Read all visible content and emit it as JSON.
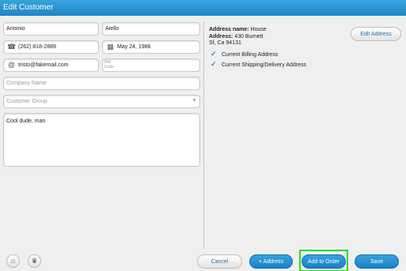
{
  "title": "Edit Customer",
  "form": {
    "first_name": "Antonio",
    "last_name": "Aiello",
    "phone": "(262) 818-2889",
    "birthday": "May 24, 1986",
    "email": "tristo@fakemail.com",
    "ref_code_placeholder": "Ref\nCode",
    "company_placeholder": "Company Name",
    "group_placeholder": "Customer Group",
    "notes": "Cool dude, man"
  },
  "address": {
    "name_label": "Address name:",
    "name_value": "House",
    "address_label": "Address:",
    "line1": "430 Burnett",
    "line2": "Sf, Ca 94131",
    "billing": "Current Billing Address",
    "shipping": "Current Shipping/Delivery Address",
    "edit_label": "Edit Address"
  },
  "footer": {
    "cancel": "Cancel",
    "add_address": "+ Address",
    "add_to_order": "Add to Order",
    "save": "Save"
  },
  "icons": {
    "phone": "phone-icon",
    "calendar": "calendar-icon",
    "email": "at-icon",
    "gift": "gift-icon",
    "trophy": "trophy-icon"
  },
  "colors": {
    "title_bar": "#2a95d3",
    "primary_button": "#1f86c6",
    "highlight": "#22e01a"
  }
}
